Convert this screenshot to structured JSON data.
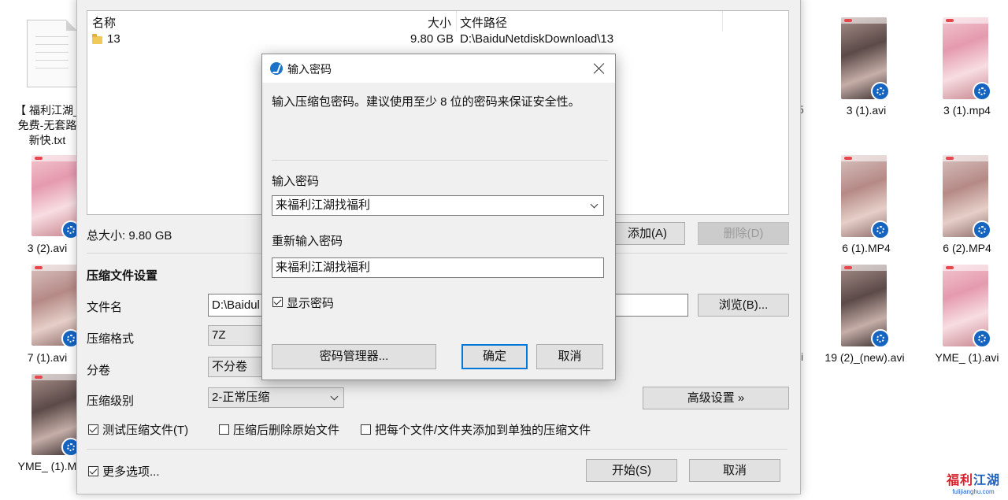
{
  "desktop": {
    "left_icons": [
      {
        "label_line1": "【 福利江湖_",
        "label_line2": "免费-无套路",
        "label_line3": "新快.txt"
      },
      {
        "label": "3 (2).avi"
      },
      {
        "label": "7 (1).avi"
      },
      {
        "label": "YME_ (1).M"
      }
    ],
    "right_icons": [
      {
        "label": "3 (1).avi"
      },
      {
        "label": "3 (1).mp4"
      },
      {
        "label": "6 (1).MP4"
      },
      {
        "label": "6 (2).MP4"
      },
      {
        "label": "19 (2)_(new).avi"
      },
      {
        "label": "YME_ (1).avi"
      }
    ],
    "partial_chars": [
      "5",
      "vi"
    ]
  },
  "main_dialog": {
    "list": {
      "col_name": "名称",
      "col_size": "大小",
      "col_path": "文件路径",
      "rows": [
        {
          "name": "13",
          "size": "9.80 GB",
          "path": "D:\\BaiduNetdiskDownload\\13"
        }
      ]
    },
    "total_size": "总大小: 9.80 GB",
    "add_button": "添加(A)",
    "delete_button": "删除(D)",
    "section_title": "压缩文件设置",
    "filename_label": "文件名",
    "filename_value": "D:\\Baidul",
    "browse_button": "浏览(B)...",
    "format_label": "压缩格式",
    "format_value": "7Z",
    "split_label": "分卷",
    "split_value": "不分卷",
    "level_label": "压缩级别",
    "level_value": "2-正常压缩",
    "advanced_button": "高级设置 »",
    "opt_test": "测试压缩文件(T)",
    "opt_delete": "压缩后删除原始文件",
    "opt_each": "把每个文件/文件夹添加到单独的压缩文件",
    "more_options": "更多选项...",
    "start_button": "开始(S)",
    "cancel_button": "取消"
  },
  "password_dialog": {
    "title": "输入密码",
    "description": "输入压缩包密码。建议使用至少 8 位的密码来保证安全性。",
    "password_label": "输入密码",
    "password_value": "来福利江湖找福利",
    "confirm_label": "重新输入密码",
    "confirm_value": "来福利江湖找福利",
    "show_password": "显示密码",
    "manager_button": "密码管理器...",
    "ok_button": "确定",
    "cancel_button": "取消"
  },
  "watermark": {
    "text_red": "福利",
    "text_blue": "江湖",
    "url": "fulijianghu.com"
  }
}
